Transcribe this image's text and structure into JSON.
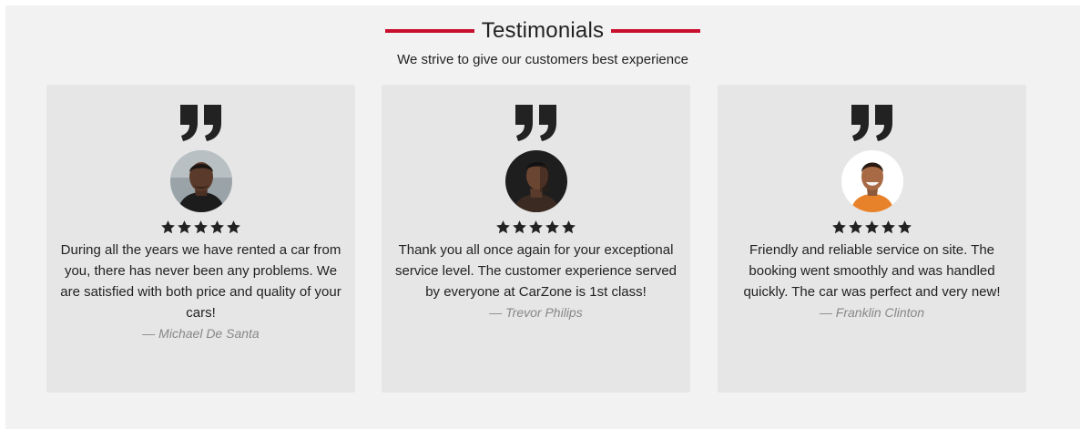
{
  "section": {
    "title": "Testimonials",
    "subtitle": "We strive to give our customers best experience",
    "accent_color": "#c8102e"
  },
  "testimonials": [
    {
      "text": "During all the years we have rented a car from you, there has never been any problems. We are satisfied with both price and quality of your cars!",
      "author": "— Michael De Santa",
      "rating": 5
    },
    {
      "text": "Thank you all once again for your exceptional service level. The customer experience served by everyone at CarZone is 1st class!",
      "author": "— Trevor Philips",
      "rating": 5
    },
    {
      "text": "Friendly and reliable service on site. The booking went smoothly and was handled quickly. The car was perfect and very new!",
      "author": "— Franklin Clinton",
      "rating": 5
    }
  ]
}
